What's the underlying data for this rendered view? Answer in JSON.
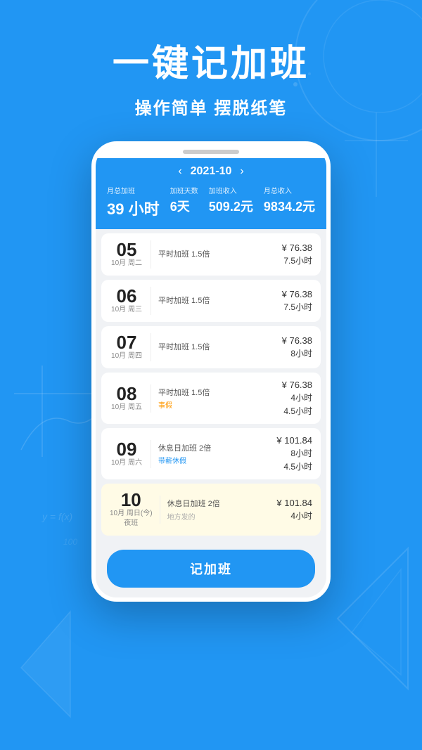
{
  "background": {
    "color": "#2196F3"
  },
  "header": {
    "main_title": "一键记加班",
    "sub_title": "操作简单 摆脱纸笔"
  },
  "app": {
    "month_nav": {
      "prev_label": "‹",
      "next_label": "›",
      "month": "2021-10"
    },
    "stats": [
      {
        "label": "月总加班",
        "value": "39 小时"
      },
      {
        "label": "加班天数",
        "value": "6天"
      },
      {
        "label": "加班收入",
        "value": "509.2元"
      },
      {
        "label": "月总收入",
        "value": "9834.2元"
      }
    ],
    "records": [
      {
        "date_num": "05",
        "date_info": "10月 周二",
        "type": "平时加班 1.5倍",
        "tag": "",
        "money": "¥ 76.38",
        "hours": "7.5小时",
        "hours2": "",
        "note": "",
        "highlighted": false
      },
      {
        "date_num": "06",
        "date_info": "10月 周三",
        "type": "平时加班 1.5倍",
        "tag": "",
        "money": "¥ 76.38",
        "hours": "7.5小时",
        "hours2": "",
        "note": "",
        "highlighted": false
      },
      {
        "date_num": "07",
        "date_info": "10月 周四",
        "type": "平时加班 1.5倍",
        "tag": "",
        "money": "¥ 76.38",
        "hours": "8小时",
        "hours2": "",
        "note": "",
        "highlighted": false
      },
      {
        "date_num": "08",
        "date_info": "10月 周五",
        "type": "平时加班 1.5倍",
        "tag": "事假",
        "tag_color": "orange",
        "money": "¥ 76.38",
        "hours": "4小时",
        "hours2": "4.5小时",
        "note": "",
        "highlighted": false
      },
      {
        "date_num": "09",
        "date_info": "10月 周六",
        "type": "休息日加班 2倍",
        "tag": "带薪休假",
        "tag_color": "blue",
        "money": "¥ 101.84",
        "hours": "8小时",
        "hours2": "4.5小时",
        "note": "",
        "highlighted": false
      },
      {
        "date_num": "10",
        "date_info": "10月 周日(今)\n夜班",
        "type": "休息日加班 2倍",
        "tag": "",
        "money": "¥ 101.84",
        "hours": "4小时",
        "hours2": "",
        "note": "地方发的",
        "highlighted": true
      }
    ],
    "record_button": "记加班"
  }
}
